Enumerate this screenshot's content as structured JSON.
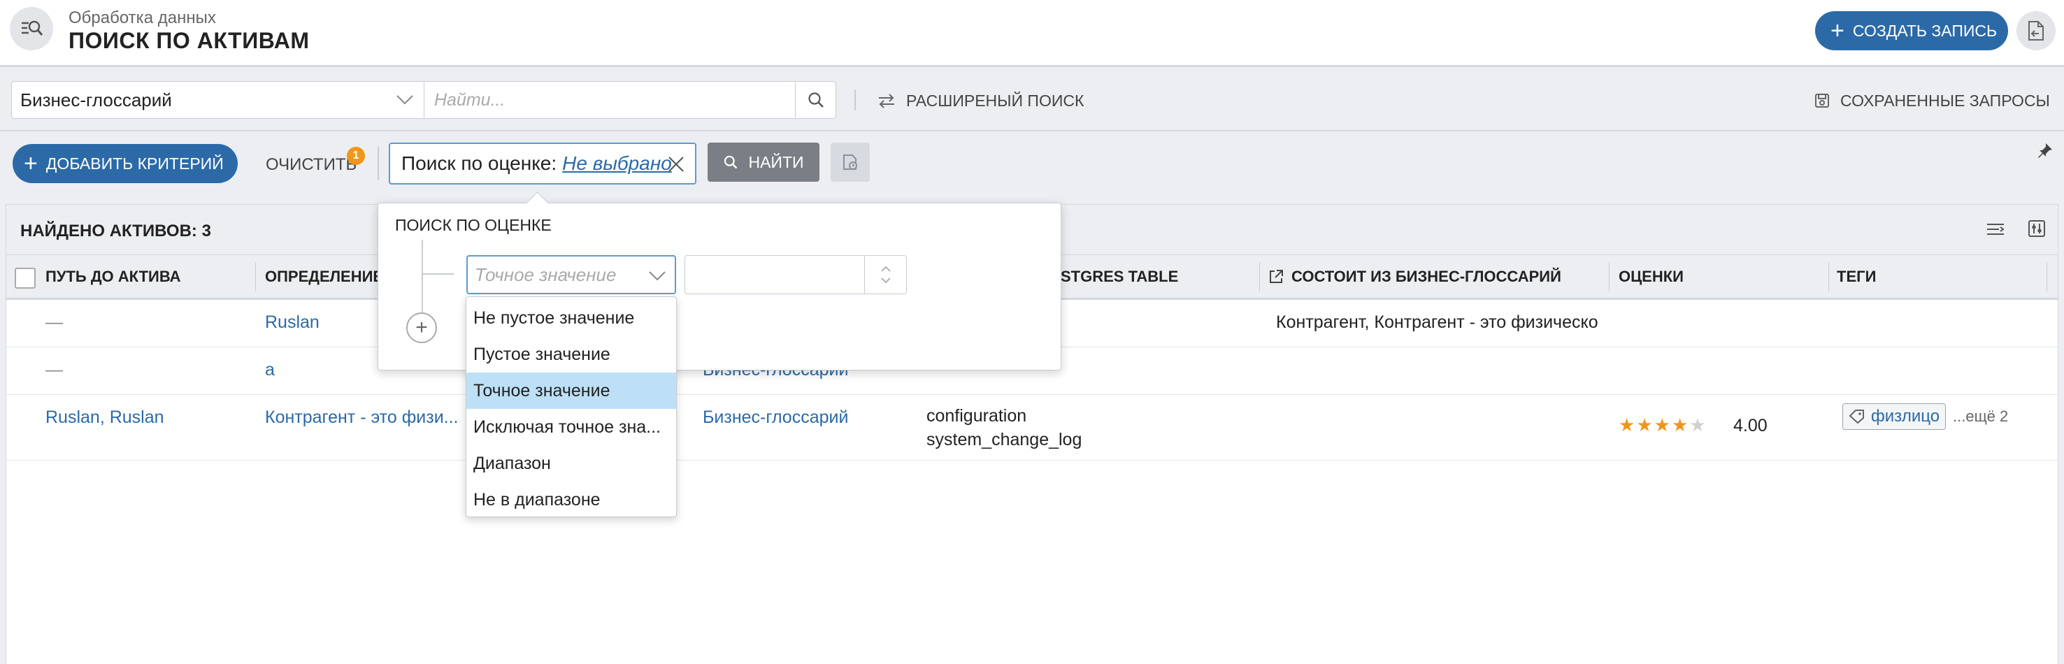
{
  "header": {
    "subtitle": "Обработка данных",
    "title": "ПОИСК ПО АКТИВАМ",
    "create_label": "СОЗДАТЬ ЗАПИСЬ"
  },
  "search": {
    "catalog": "Бизнес-глоссарий",
    "placeholder": "Найти...",
    "advanced_label": "РАСШИРЕНЫЙ ПОИСК",
    "saved_label": "СОХРАНЕННЫЕ ЗАПРОСЫ"
  },
  "criteria": {
    "add_label": "ДОБАВИТЬ КРИТЕРИЙ",
    "clear_label": "ОЧИСТИТЬ",
    "clear_badge": "1",
    "chip_label": "Поиск по оценке:",
    "chip_value": "Не выбрано",
    "find_label": "НАЙТИ"
  },
  "results": {
    "found_label": "НАЙДЕНО АКТИВОВ: 3",
    "columns": [
      "ПУТЬ ДО АКТИВА",
      "ОПРЕДЕЛЕНИЕ",
      "STGRES TABLE",
      "СОСТОИТ ИЗ БИЗНЕС-ГЛОССАРИЙ",
      "ОЦЕНКИ",
      "ТЕГИ"
    ],
    "rows": [
      {
        "path": "—",
        "definition": "Ruslan",
        "catalog": "",
        "tables": [
          "",
          ""
        ],
        "consists": "Контрагент, Контрагент - это физическо"
      },
      {
        "path": "—",
        "definition": "а",
        "catalog": "Бизнес-глоссарий",
        "tables": [
          "",
          ""
        ],
        "consists": ""
      },
      {
        "path": "Ruslan, Ruslan",
        "definition": "Контрагент - это физи...",
        "catalog": "Бизнес-глоссарий",
        "tables": [
          "configuration",
          "system_change_log"
        ],
        "consists": "",
        "rating": 4,
        "rating_text": "4.00",
        "tag": "физлицо",
        "more": "...ещё 2"
      }
    ]
  },
  "popover": {
    "title": "ПОИСК ПО ОЦЕНКЕ",
    "select_placeholder": "Точное значение",
    "options": [
      "Не пустое значение",
      "Пустое значение",
      "Точное значение",
      "Исключая точное зна...",
      "Диапазон",
      "Не в диапазоне"
    ],
    "selected_option": "Точное значение"
  },
  "colors": {
    "accent": "#2c6aa7",
    "badge": "#f0961c",
    "selected_option": "#bde0f7"
  }
}
